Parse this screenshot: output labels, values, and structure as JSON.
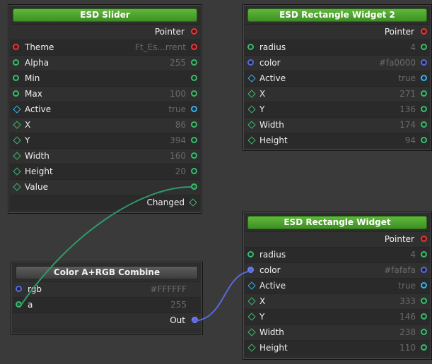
{
  "colors": {
    "canvas": "#3a3a3a",
    "title_green": "#4ca42e",
    "wire_green": "#2f9a6a",
    "wire_blue": "#5a6ad8"
  },
  "nodes": {
    "slider": {
      "title": "ESD Slider",
      "rows": [
        {
          "name": "",
          "value": "",
          "out": "Pointer"
        },
        {
          "name": "Theme",
          "value": "Ft_Es...rrent"
        },
        {
          "name": "Alpha",
          "value": "255"
        },
        {
          "name": "Min",
          "value": ""
        },
        {
          "name": "Max",
          "value": "100"
        },
        {
          "name": "Active",
          "value": "true"
        },
        {
          "name": "X",
          "value": "86"
        },
        {
          "name": "Y",
          "value": "394"
        },
        {
          "name": "Width",
          "value": "160"
        },
        {
          "name": "Height",
          "value": "20"
        },
        {
          "name": "Value",
          "value": ""
        },
        {
          "name": "",
          "value": "",
          "out": "Changed"
        }
      ]
    },
    "rect2": {
      "title": "ESD Rectangle Widget 2",
      "rows": [
        {
          "name": "",
          "value": "",
          "out": "Pointer"
        },
        {
          "name": "radius",
          "value": "4"
        },
        {
          "name": "color",
          "value": "#fa0000"
        },
        {
          "name": "Active",
          "value": "true"
        },
        {
          "name": "X",
          "value": "271"
        },
        {
          "name": "Y",
          "value": "136"
        },
        {
          "name": "Width",
          "value": "174"
        },
        {
          "name": "Height",
          "value": "94"
        }
      ]
    },
    "combine": {
      "title": "Color A+RGB Combine",
      "rows": [
        {
          "name": "rgb",
          "value": "#FFFFFF"
        },
        {
          "name": "a",
          "value": "255"
        },
        {
          "name": "",
          "value": "",
          "out": "Out"
        }
      ]
    },
    "rect": {
      "title": "ESD Rectangle Widget",
      "rows": [
        {
          "name": "",
          "value": "",
          "out": "Pointer"
        },
        {
          "name": "radius",
          "value": "4"
        },
        {
          "name": "color",
          "value": "#fafafa"
        },
        {
          "name": "Active",
          "value": "true"
        },
        {
          "name": "X",
          "value": "333"
        },
        {
          "name": "Y",
          "value": "146"
        },
        {
          "name": "Width",
          "value": "238"
        },
        {
          "name": "Height",
          "value": "110"
        }
      ]
    }
  }
}
